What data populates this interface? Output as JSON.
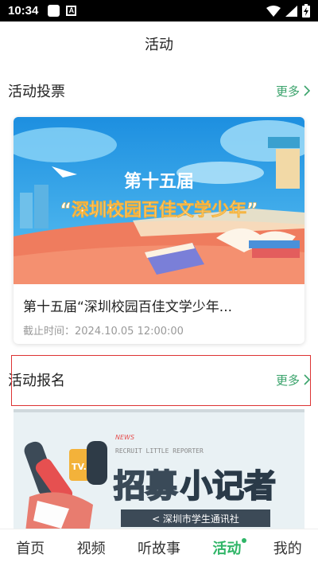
{
  "status_bar": {
    "time": "10:34",
    "notification_icon": "a-icon"
  },
  "header": {
    "title": "活动"
  },
  "vote_section": {
    "title": "活动投票",
    "more_label": "更多",
    "card": {
      "banner_line1": "第十五届",
      "banner_line2": "“深圳校园百佳文学少年”",
      "title": "第十五届“深圳校园百佳文学少年...",
      "deadline": "截止时间：2024.10.05 12:00:00"
    }
  },
  "signup_section": {
    "title": "活动报名",
    "more_label": "更多",
    "card": {
      "news_tag": "NEWS",
      "english_line": "RECRUIT LITTLE REPORTER",
      "headline_part1": "招募",
      "headline_part2": "小记者",
      "mic_label": "TV.N",
      "subtitle": "< 深圳市学生通讯社"
    }
  },
  "bottom_nav": {
    "items": [
      {
        "label": "首页"
      },
      {
        "label": "视频"
      },
      {
        "label": "听故事"
      },
      {
        "label": "活动"
      },
      {
        "label": "我的"
      }
    ]
  },
  "colors": {
    "accent": "#2fb567",
    "more_link": "#3aa36b",
    "highlight": "#dd3333"
  }
}
